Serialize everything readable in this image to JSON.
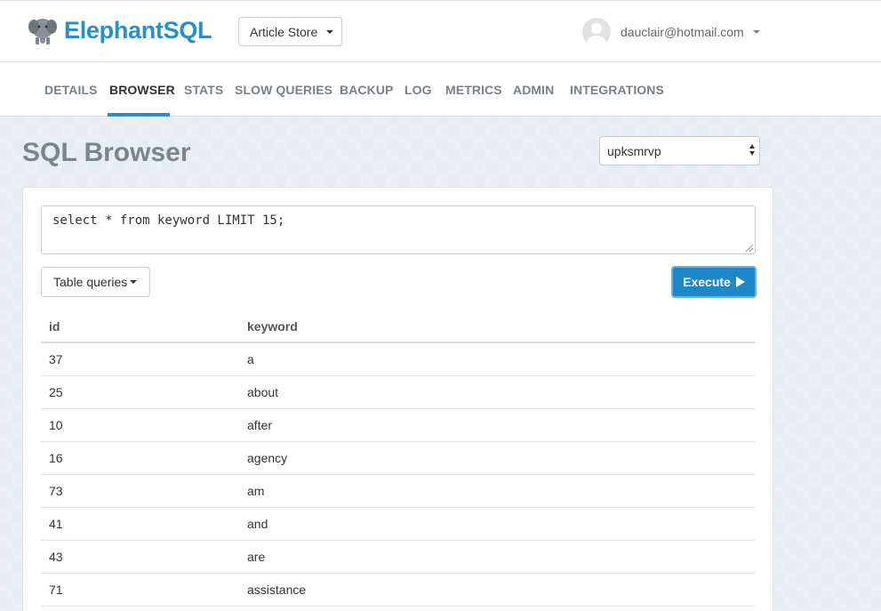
{
  "header": {
    "brand": "ElephantSQL",
    "store_label": "Article Store",
    "user_email": "dauclair@hotmail.com"
  },
  "nav": {
    "items": [
      {
        "label": "DETAILS"
      },
      {
        "label": "BROWSER"
      },
      {
        "label": "STATS"
      },
      {
        "label": "SLOW QUERIES"
      },
      {
        "label": "BACKUP"
      },
      {
        "label": "LOG"
      },
      {
        "label": "METRICS"
      },
      {
        "label": "ADMIN"
      },
      {
        "label": "INTEGRATIONS"
      }
    ],
    "active": "BROWSER"
  },
  "page": {
    "title": "SQL Browser",
    "instance": "upksmrvp"
  },
  "query": {
    "text": "select * from keyword LIMIT 15;",
    "table_queries_label": "Table queries",
    "execute_label": "Execute"
  },
  "results": {
    "columns": [
      "id",
      "keyword"
    ],
    "rows": [
      [
        "37",
        "a"
      ],
      [
        "25",
        "about"
      ],
      [
        "10",
        "after"
      ],
      [
        "16",
        "agency"
      ],
      [
        "73",
        "am"
      ],
      [
        "41",
        "and"
      ],
      [
        "43",
        "are"
      ],
      [
        "71",
        "assistance"
      ]
    ]
  },
  "colors": {
    "brand": "#2a8fc7",
    "execute": "#1f87c6"
  }
}
